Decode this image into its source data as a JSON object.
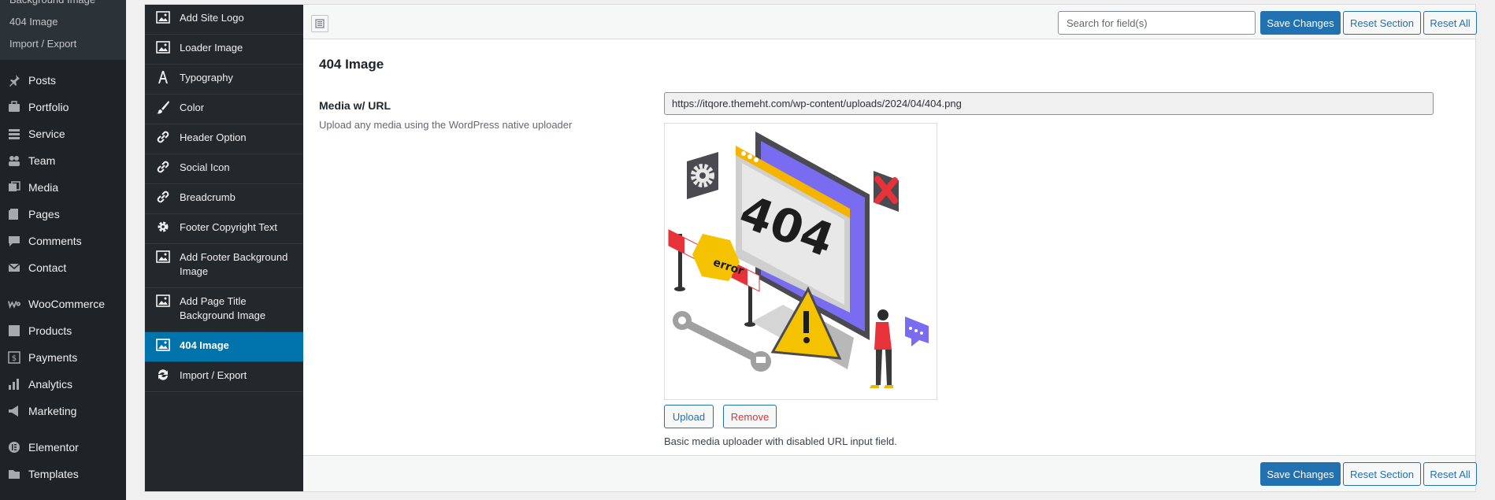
{
  "wp_sidebar": {
    "submenu": [
      "Background Image",
      "404 Image",
      "Import / Export"
    ],
    "items": [
      {
        "label": "Posts",
        "icon": "pin-icon"
      },
      {
        "label": "Portfolio",
        "icon": "portfolio-icon"
      },
      {
        "label": "Service",
        "icon": "list-icon"
      },
      {
        "label": "Team",
        "icon": "team-icon"
      },
      {
        "label": "Media",
        "icon": "media-icon"
      },
      {
        "label": "Pages",
        "icon": "pages-icon"
      },
      {
        "label": "Comments",
        "icon": "comments-icon"
      },
      {
        "label": "Contact",
        "icon": "mail-icon"
      },
      {
        "label": "WooCommerce",
        "icon": "woo-icon"
      },
      {
        "label": "Products",
        "icon": "products-icon"
      },
      {
        "label": "Payments",
        "icon": "payments-icon"
      },
      {
        "label": "Analytics",
        "icon": "analytics-icon"
      },
      {
        "label": "Marketing",
        "icon": "marketing-icon"
      },
      {
        "label": "Elementor",
        "icon": "elementor-icon"
      },
      {
        "label": "Templates",
        "icon": "templates-icon"
      }
    ]
  },
  "redux_nav": {
    "items": [
      {
        "label": "Add Site Logo",
        "icon": "image-icon"
      },
      {
        "label": "Loader Image",
        "icon": "image-icon"
      },
      {
        "label": "Typography",
        "icon": "typography-icon"
      },
      {
        "label": "Color",
        "icon": "brush-icon"
      },
      {
        "label": "Header Option",
        "icon": "link-icon"
      },
      {
        "label": "Social Icon",
        "icon": "link-icon"
      },
      {
        "label": "Breadcrumb",
        "icon": "link-icon"
      },
      {
        "label": "Footer Copyright Text",
        "icon": "gear-icon"
      },
      {
        "label": "Add Footer Background Image",
        "icon": "image-icon"
      },
      {
        "label": "Add Page Title Background Image",
        "icon": "image-icon"
      },
      {
        "label": "404 Image",
        "icon": "image-icon",
        "active": true
      },
      {
        "label": "Import / Export",
        "icon": "refresh-icon"
      }
    ]
  },
  "toolbar": {
    "search_placeholder": "Search for field(s)",
    "save_label": "Save Changes",
    "reset_section_label": "Reset Section",
    "reset_all_label": "Reset All"
  },
  "section": {
    "title": "404 Image",
    "field_label": "Media w/ URL",
    "field_desc": "Upload any media using the WordPress native uploader",
    "url_value": "https://itqore.themeht.com/wp-content/uploads/2024/04/404.png",
    "preview_text": "404",
    "preview_badge": "error",
    "upload_label": "Upload",
    "remove_label": "Remove",
    "help_text": "Basic media uploader with disabled URL input field."
  },
  "colors": {
    "wp_sidebar_bg": "#1d2327",
    "redux_nav_bg": "#23282d",
    "active_item": "#0073aa",
    "primary": "#2271b1",
    "danger": "#d63638"
  }
}
